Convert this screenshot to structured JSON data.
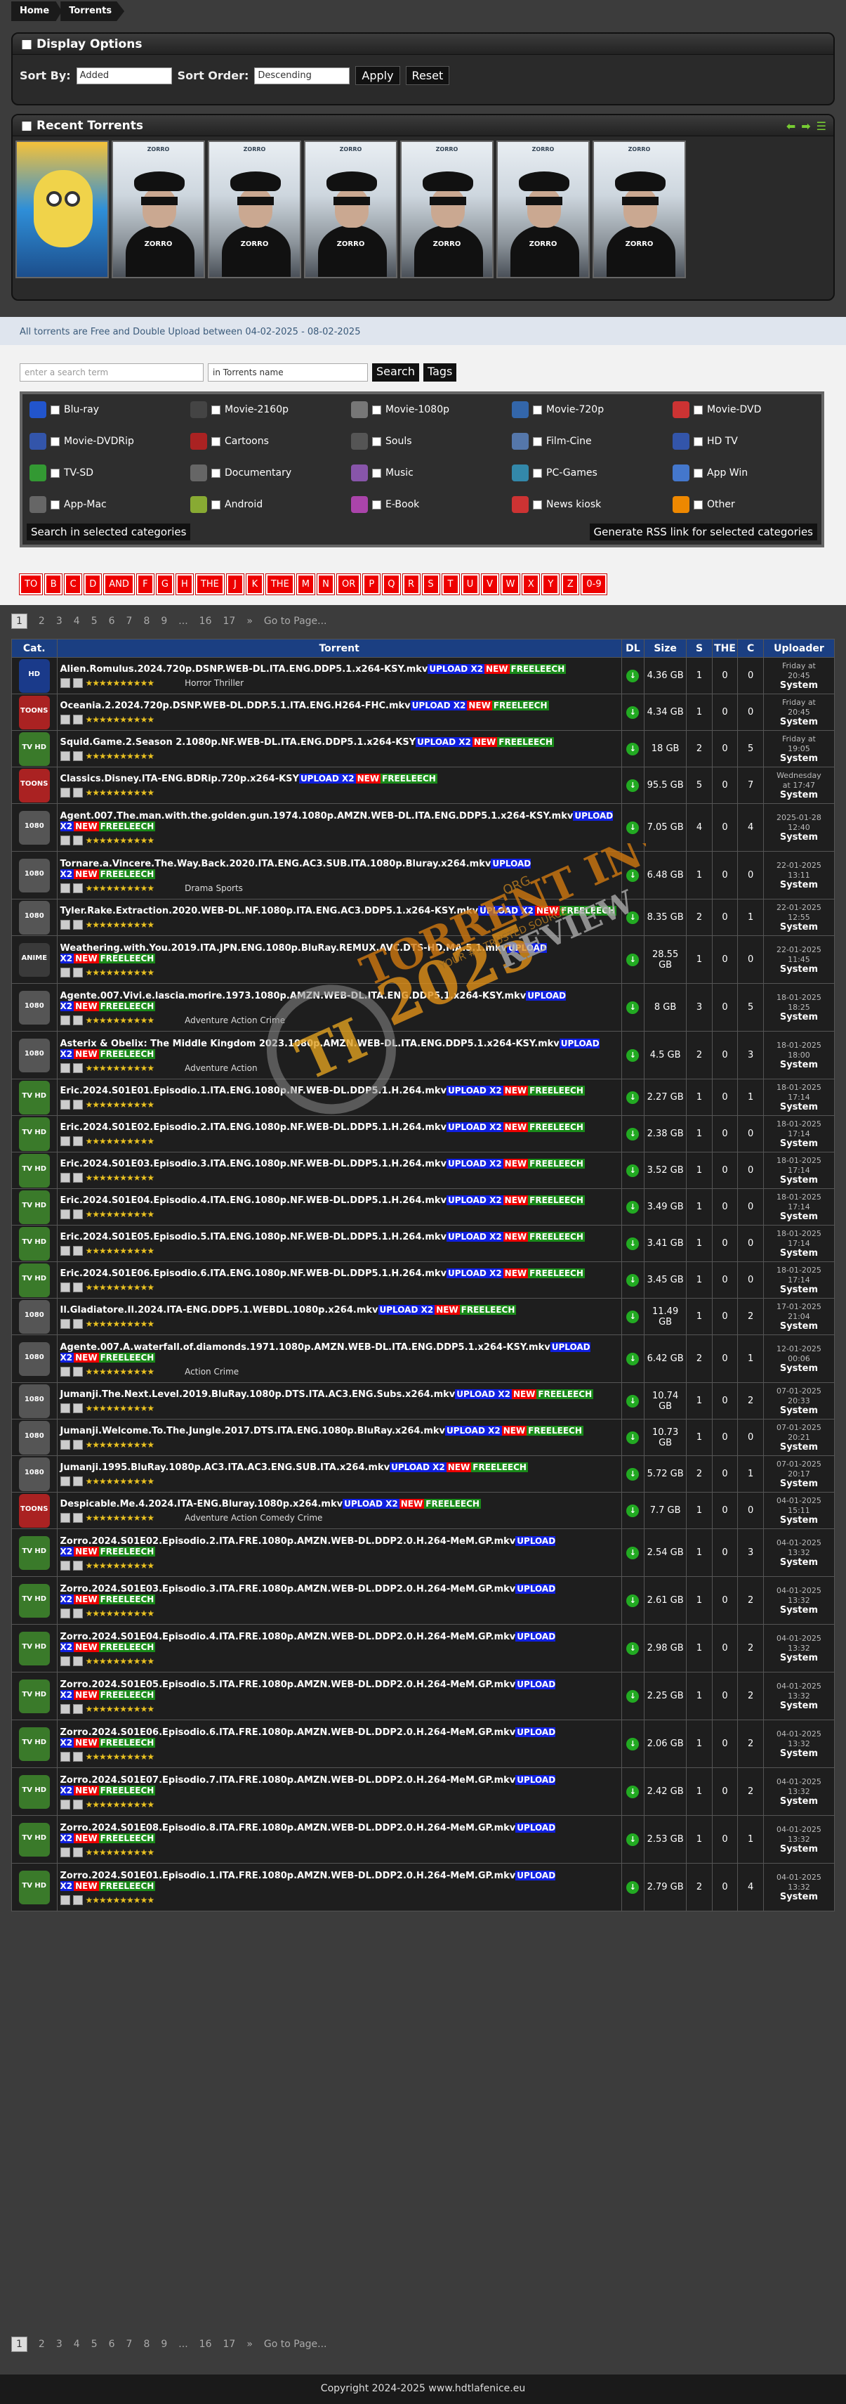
{
  "breadcrumb": [
    "Home",
    "Torrents"
  ],
  "display_options": {
    "title": "Display Options",
    "sort_by_label": "Sort By:",
    "sort_by_value": "Added",
    "sort_order_label": "Sort Order:",
    "sort_order_value": "Descending",
    "apply": "Apply",
    "reset": "Reset"
  },
  "recent": {
    "title": "Recent Torrents",
    "poster_title": "ZORRO",
    "poster_sub": "ZORRO"
  },
  "note": "All torrents are Free and Double Upload between 04-02-2025 - 08-02-2025",
  "search": {
    "placeholder": "enter a search term",
    "scope": "in Torrents name",
    "search": "Search",
    "tags": "Tags"
  },
  "categories": [
    "Blu-ray",
    "Movie-2160p",
    "Movie-1080p",
    "Movie-720p",
    "Movie-DVD",
    "Movie-DVDRip",
    "Cartoons",
    "Souls",
    "Film-Cine",
    "HD TV",
    "TV-SD",
    "Documentary",
    "Music",
    "PC-Games",
    "App Win",
    "App-Mac",
    "Android",
    "E-Book",
    "News kiosk",
    "Other"
  ],
  "cat_colors": [
    "#2255cc",
    "#444",
    "#777",
    "#3366aa",
    "#cc3333",
    "#3355aa",
    "#aa2222",
    "#555",
    "#5577aa",
    "#3355aa",
    "#339933",
    "#666",
    "#8855aa",
    "#3388aa",
    "#4477cc",
    "#666",
    "#88aa33",
    "#aa44aa",
    "#cc3333",
    "#ee8800"
  ],
  "search_selected": "Search in selected categories",
  "rss": "Generate RSS link for selected categories",
  "letters": [
    "TO",
    "B",
    "C",
    "D",
    "AND",
    "F",
    "G",
    "H",
    "THE",
    "J",
    "K",
    "THE",
    "M",
    "N",
    "OR",
    "P",
    "Q",
    "R",
    "S",
    "T",
    "U",
    "V",
    "W",
    "X",
    "Y",
    "Z",
    "0-9"
  ],
  "pager": {
    "pages": [
      "1",
      "2",
      "3",
      "4",
      "5",
      "6",
      "7",
      "8",
      "9",
      "...",
      "16",
      "17",
      "»",
      "Go to Page..."
    ]
  },
  "table": {
    "headers": [
      "Cat.",
      "Torrent",
      "DL",
      "Size",
      "S",
      "THE",
      "C",
      "Uploader"
    ],
    "tags": {
      "up": "UPLOAD X2",
      "new": "NEW",
      "free": "FREELEECH"
    },
    "uploader": "System",
    "rows": [
      {
        "name": "Alien.Romulus.2024.720p.DSNP.WEB-DL.ITA.ENG.DDP5.1.x264-KSY.mkv",
        "genre": "Horror  Thriller",
        "size": "4.36 GB",
        "s": "1",
        "l": "0",
        "c": "0",
        "date": "Friday at",
        "time": "20:45",
        "cat": "#1a3a8a",
        "lbl": "HD"
      },
      {
        "name": "Oceania.2.2024.720p.DSNP.WEB-DL.DDP.5.1.ITA.ENG.H264-FHC.mkv",
        "genre": "",
        "size": "4.34 GB",
        "s": "1",
        "l": "0",
        "c": "0",
        "date": "Friday at",
        "time": "20:45",
        "cat": "#aa2222",
        "lbl": "TOONS"
      },
      {
        "name": "Squid.Game.2.Season 2.1080p.NF.WEB-DL.ITA.ENG.DDP5.1.x264-KSY",
        "genre": "",
        "size": "18 GB",
        "s": "2",
        "l": "0",
        "c": "5",
        "date": "Friday at",
        "time": "19:05",
        "cat": "#3a7a2a",
        "lbl": "TV HD"
      },
      {
        "name": "Classics.Disney.ITA-ENG.BDRip.720p.x264-KSY",
        "genre": "",
        "size": "95.5 GB",
        "s": "5",
        "l": "0",
        "c": "7",
        "date": "Wednesday",
        "time": "at 17:47",
        "cat": "#aa2222",
        "lbl": "TOONS"
      },
      {
        "name": "Agent.007.The.man.with.the.golden.gun.1974.1080p.AMZN.WEB-DL.ITA.ENG.DDP5.1.x264-KSY.mkv",
        "genre": "",
        "size": "7.05 GB",
        "s": "4",
        "l": "0",
        "c": "4",
        "date": "2025-01-28",
        "time": "12:40",
        "cat": "#555",
        "lbl": "1080"
      },
      {
        "name": "Tornare.a.Vincere.The.Way.Back.2020.ITA.ENG.AC3.SUB.ITA.1080p.Bluray.x264.mkv",
        "genre": "Drama  Sports",
        "size": "6.48 GB",
        "s": "1",
        "l": "0",
        "c": "0",
        "date": "22-01-2025",
        "time": "13:11",
        "cat": "#555",
        "lbl": "1080"
      },
      {
        "name": "Tyler.Rake.Extraction.2020.WEB-DL.NF.1080p.ITA.ENG.AC3.DDP5.1.x264-KSY.mkv",
        "genre": "",
        "size": "8.35 GB",
        "s": "2",
        "l": "0",
        "c": "1",
        "date": "22-01-2025",
        "time": "12:55",
        "cat": "#555",
        "lbl": "1080"
      },
      {
        "name": "Weathering.with.You.2019.ITA.JPN.ENG.1080p.BluRay.REMUX.AVC.DTS-HD.MA.5.1.mkv",
        "genre": "",
        "size": "28.55 GB",
        "s": "1",
        "l": "0",
        "c": "0",
        "date": "22-01-2025",
        "time": "11:45",
        "cat": "#3a3a3a",
        "lbl": "ANIME"
      },
      {
        "name": "Agente.007.Vivi.e.lascia.morire.1973.1080p.AMZN.WEB-DL.ITA.ENG.DDP5.1.x264-KSY.mkv",
        "genre": "Adventure  Action  Crime",
        "size": "8 GB",
        "s": "3",
        "l": "0",
        "c": "5",
        "date": "18-01-2025",
        "time": "18:25",
        "cat": "#555",
        "lbl": "1080"
      },
      {
        "name": "Asterix & Obelix: The Middle Kingdom 2023.1080p.AMZN.WEB-DL.ITA.ENG.DDP5.1.x264-KSY.mkv",
        "genre": "Adventure  Action",
        "size": "4.5 GB",
        "s": "2",
        "l": "0",
        "c": "3",
        "date": "18-01-2025",
        "time": "18:00",
        "cat": "#555",
        "lbl": "1080"
      },
      {
        "name": "Eric.2024.S01E01.Episodio.1.ITA.ENG.1080p.NF.WEB-DL.DDP5.1.H.264.mkv",
        "genre": "",
        "size": "2.27 GB",
        "s": "1",
        "l": "0",
        "c": "1",
        "date": "18-01-2025",
        "time": "17:14",
        "cat": "#3a7a2a",
        "lbl": "TV HD"
      },
      {
        "name": "Eric.2024.S01E02.Episodio.2.ITA.ENG.1080p.NF.WEB-DL.DDP5.1.H.264.mkv",
        "genre": "",
        "size": "2.38 GB",
        "s": "1",
        "l": "0",
        "c": "0",
        "date": "18-01-2025",
        "time": "17:14",
        "cat": "#3a7a2a",
        "lbl": "TV HD"
      },
      {
        "name": "Eric.2024.S01E03.Episodio.3.ITA.ENG.1080p.NF.WEB-DL.DDP5.1.H.264.mkv",
        "genre": "",
        "size": "3.52 GB",
        "s": "1",
        "l": "0",
        "c": "0",
        "date": "18-01-2025",
        "time": "17:14",
        "cat": "#3a7a2a",
        "lbl": "TV HD"
      },
      {
        "name": "Eric.2024.S01E04.Episodio.4.ITA.ENG.1080p.NF.WEB-DL.DDP5.1.H.264.mkv",
        "genre": "",
        "size": "3.49 GB",
        "s": "1",
        "l": "0",
        "c": "0",
        "date": "18-01-2025",
        "time": "17:14",
        "cat": "#3a7a2a",
        "lbl": "TV HD"
      },
      {
        "name": "Eric.2024.S01E05.Episodio.5.ITA.ENG.1080p.NF.WEB-DL.DDP5.1.H.264.mkv",
        "genre": "",
        "size": "3.41 GB",
        "s": "1",
        "l": "0",
        "c": "0",
        "date": "18-01-2025",
        "time": "17:14",
        "cat": "#3a7a2a",
        "lbl": "TV HD"
      },
      {
        "name": "Eric.2024.S01E06.Episodio.6.ITA.ENG.1080p.NF.WEB-DL.DDP5.1.H.264.mkv",
        "genre": "",
        "size": "3.45 GB",
        "s": "1",
        "l": "0",
        "c": "0",
        "date": "18-01-2025",
        "time": "17:14",
        "cat": "#3a7a2a",
        "lbl": "TV HD"
      },
      {
        "name": "Il.Gladiatore.II.2024.ITA-ENG.DDP5.1.WEBDL.1080p.x264.mkv",
        "genre": "",
        "size": "11.49 GB",
        "s": "1",
        "l": "0",
        "c": "2",
        "date": "17-01-2025",
        "time": "21:04",
        "cat": "#555",
        "lbl": "1080"
      },
      {
        "name": "Agente.007.A.waterfall.of.diamonds.1971.1080p.AMZN.WEB-DL.ITA.ENG.DDP5.1.x264-KSY.mkv",
        "genre": "Action  Crime",
        "size": "6.42 GB",
        "s": "2",
        "l": "0",
        "c": "1",
        "date": "12-01-2025",
        "time": "00:06",
        "cat": "#555",
        "lbl": "1080"
      },
      {
        "name": "Jumanji.The.Next.Level.2019.BluRay.1080p.DTS.ITA.AC3.ENG.Subs.x264.mkv",
        "genre": "",
        "size": "10.74 GB",
        "s": "1",
        "l": "0",
        "c": "2",
        "date": "07-01-2025",
        "time": "20:33",
        "cat": "#555",
        "lbl": "1080"
      },
      {
        "name": "Jumanji.Welcome.To.The.Jungle.2017.DTS.ITA.ENG.1080p.BluRay.x264.mkv",
        "genre": "",
        "size": "10.73 GB",
        "s": "1",
        "l": "0",
        "c": "0",
        "date": "07-01-2025",
        "time": "20:21",
        "cat": "#555",
        "lbl": "1080"
      },
      {
        "name": "Jumanji.1995.BluRay.1080p.AC3.ITA.AC3.ENG.SUB.ITA.x264.mkv",
        "genre": "",
        "size": "5.72 GB",
        "s": "2",
        "l": "0",
        "c": "1",
        "date": "07-01-2025",
        "time": "20:17",
        "cat": "#555",
        "lbl": "1080"
      },
      {
        "name": "Despicable.Me.4.2024.ITA-ENG.Bluray.1080p.x264.mkv",
        "genre": "Adventure  Action  Comedy  Crime",
        "size": "7.7 GB",
        "s": "1",
        "l": "0",
        "c": "0",
        "date": "04-01-2025",
        "time": "15:11",
        "cat": "#aa2222",
        "lbl": "TOONS"
      },
      {
        "name": "Zorro.2024.S01E02.Episodio.2.ITA.FRE.1080p.AMZN.WEB-DL.DDP2.0.H.264-MeM.GP.mkv",
        "genre": "",
        "size": "2.54 GB",
        "s": "1",
        "l": "0",
        "c": "3",
        "date": "04-01-2025",
        "time": "13:32",
        "cat": "#3a7a2a",
        "lbl": "TV HD"
      },
      {
        "name": "Zorro.2024.S01E03.Episodio.3.ITA.FRE.1080p.AMZN.WEB-DL.DDP2.0.H.264-MeM.GP.mkv",
        "genre": "",
        "size": "2.61 GB",
        "s": "1",
        "l": "0",
        "c": "2",
        "date": "04-01-2025",
        "time": "13:32",
        "cat": "#3a7a2a",
        "lbl": "TV HD"
      },
      {
        "name": "Zorro.2024.S01E04.Episodio.4.ITA.FRE.1080p.AMZN.WEB-DL.DDP2.0.H.264-MeM.GP.mkv",
        "genre": "",
        "size": "2.98 GB",
        "s": "1",
        "l": "0",
        "c": "2",
        "date": "04-01-2025",
        "time": "13:32",
        "cat": "#3a7a2a",
        "lbl": "TV HD"
      },
      {
        "name": "Zorro.2024.S01E05.Episodio.5.ITA.FRE.1080p.AMZN.WEB-DL.DDP2.0.H.264-MeM.GP.mkv",
        "genre": "",
        "size": "2.25 GB",
        "s": "1",
        "l": "0",
        "c": "2",
        "date": "04-01-2025",
        "time": "13:32",
        "cat": "#3a7a2a",
        "lbl": "TV HD"
      },
      {
        "name": "Zorro.2024.S01E06.Episodio.6.ITA.FRE.1080p.AMZN.WEB-DL.DDP2.0.H.264-MeM.GP.mkv",
        "genre": "",
        "size": "2.06 GB",
        "s": "1",
        "l": "0",
        "c": "2",
        "date": "04-01-2025",
        "time": "13:32",
        "cat": "#3a7a2a",
        "lbl": "TV HD"
      },
      {
        "name": "Zorro.2024.S01E07.Episodio.7.ITA.FRE.1080p.AMZN.WEB-DL.DDP2.0.H.264-MeM.GP.mkv",
        "genre": "",
        "size": "2.42 GB",
        "s": "1",
        "l": "0",
        "c": "2",
        "date": "04-01-2025",
        "time": "13:32",
        "cat": "#3a7a2a",
        "lbl": "TV HD"
      },
      {
        "name": "Zorro.2024.S01E08.Episodio.8.ITA.FRE.1080p.AMZN.WEB-DL.DDP2.0.H.264-MeM.GP.mkv",
        "genre": "",
        "size": "2.53 GB",
        "s": "1",
        "l": "0",
        "c": "1",
        "date": "04-01-2025",
        "time": "13:32",
        "cat": "#3a7a2a",
        "lbl": "TV HD"
      },
      {
        "name": "Zorro.2024.S01E01.Episodio.1.ITA.FRE.1080p.AMZN.WEB-DL.DDP2.0.H.264-MeM.GP.mkv",
        "genre": "",
        "size": "2.79 GB",
        "s": "2",
        "l": "0",
        "c": "4",
        "date": "04-01-2025",
        "time": "13:32",
        "cat": "#3a7a2a",
        "lbl": "TV HD"
      }
    ]
  },
  "watermark": {
    "line1": "TORRENT INVITES",
    "line2": "REVIEW",
    "year": "2025",
    "logo": "TI",
    "site": ".ORG",
    "tagline": "YOUR #1 TRUSTED SOURCE"
  },
  "footer": "Copyright 2024-2025 www.hdtlafenice.eu"
}
